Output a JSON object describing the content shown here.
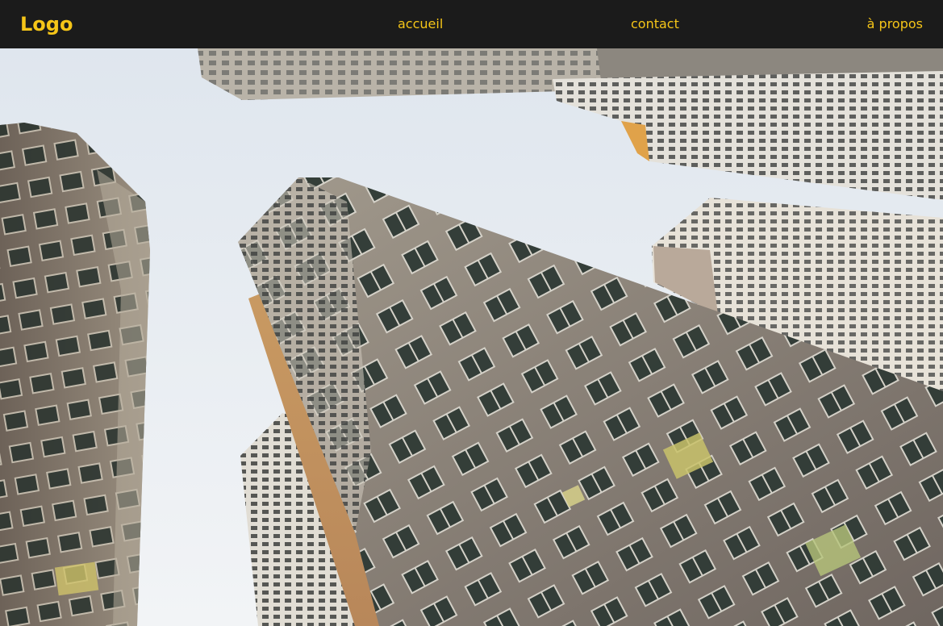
{
  "header": {
    "logo": "Logo",
    "nav": [
      {
        "label": "accueil"
      },
      {
        "label": "contact"
      },
      {
        "label": "à propos"
      }
    ]
  },
  "colors": {
    "navbar_bg": "#1b1b1b",
    "accent": "#f5c518",
    "sky": "#e8ecf0"
  },
  "hero": {
    "subject": "low-angle-photo-of-high-rise-apartment-towers"
  }
}
